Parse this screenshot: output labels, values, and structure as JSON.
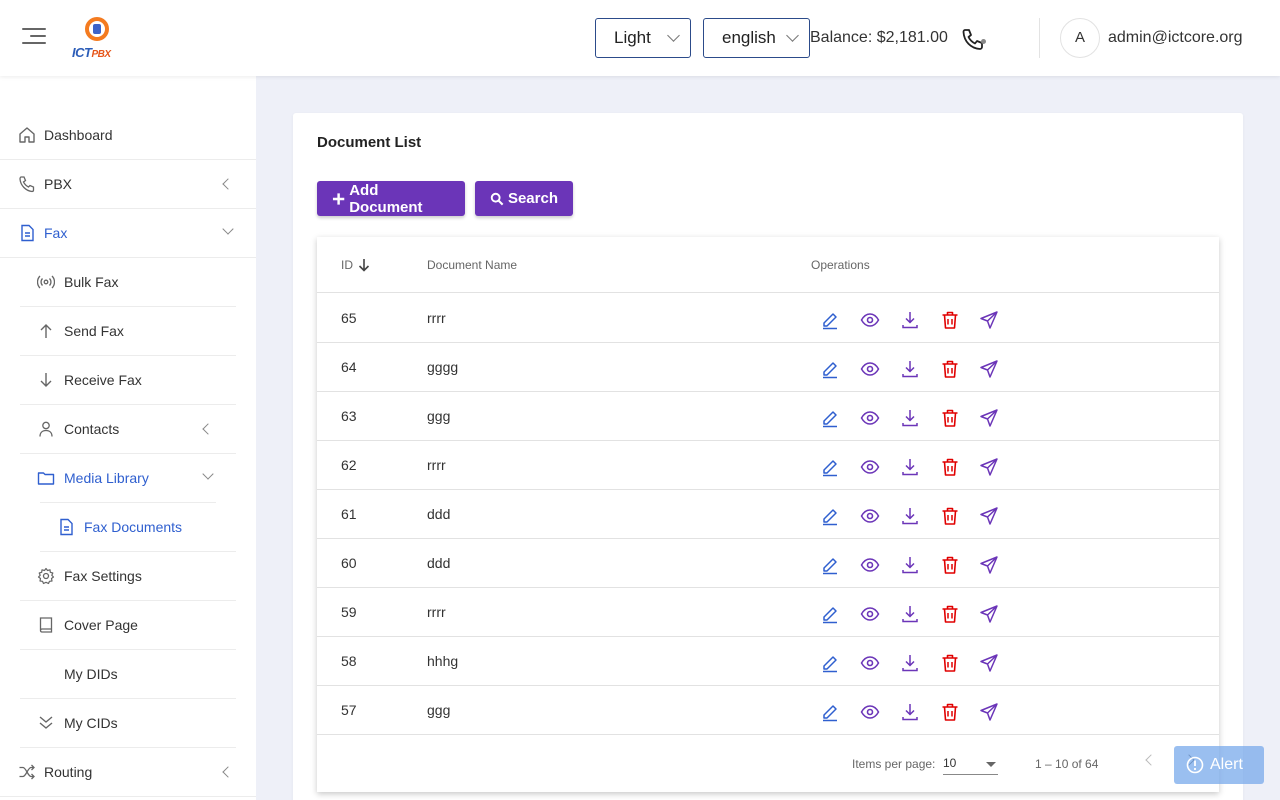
{
  "header": {
    "logo_text_ict": "ICT",
    "logo_text_pbx": "PBX",
    "theme_value": "Light",
    "lang_value": "english",
    "balance": "Balance: $2,181.00",
    "avatar_letter": "A",
    "user_email": "admin@ictcore.org"
  },
  "sidebar": {
    "dashboard": "Dashboard",
    "pbx": "PBX",
    "fax": "Fax",
    "bulk_fax": "Bulk Fax",
    "send_fax": "Send Fax",
    "receive_fax": "Receive Fax",
    "contacts": "Contacts",
    "media_library": "Media Library",
    "fax_documents": "Fax Documents",
    "fax_settings": "Fax Settings",
    "cover_page": "Cover Page",
    "my_dids": "My DIDs",
    "my_cids": "My CIDs",
    "routing": "Routing"
  },
  "main": {
    "title": "Document List",
    "add_button": "Add Document",
    "search_button": "Search",
    "columns": {
      "id": "ID",
      "name": "Document Name",
      "ops": "Operations"
    },
    "rows": [
      {
        "id": "65",
        "name": "rrrr"
      },
      {
        "id": "64",
        "name": "gggg"
      },
      {
        "id": "63",
        "name": "ggg"
      },
      {
        "id": "62",
        "name": "rrrr"
      },
      {
        "id": "61",
        "name": "ddd"
      },
      {
        "id": "60",
        "name": "ddd"
      },
      {
        "id": "59",
        "name": "rrrr"
      },
      {
        "id": "58",
        "name": "hhhg"
      },
      {
        "id": "57",
        "name": "ggg"
      }
    ],
    "pager": {
      "items_per_page_label": "Items per page:",
      "items_per_page": "10",
      "range": "1 – 10 of 64"
    }
  },
  "alert": "Alert",
  "colors": {
    "primary": "#6b35b8",
    "active_link": "#2f5fcf",
    "edit_icon": "#2f5fcf",
    "delete_icon": "#e00000"
  }
}
